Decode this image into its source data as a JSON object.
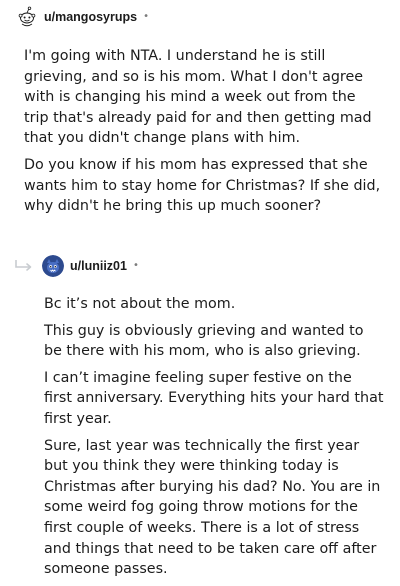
{
  "comments": [
    {
      "username": "u/mangosyrups",
      "avatar_icon": "snoo-avatar-icon",
      "separator": "•",
      "paragraphs": [
        "I'm going with NTA. I understand he is still grieving, and so is his mom. What I don't agree with is changing his mind a week out from the trip that's already paid for and then getting mad that you didn't change plans with him.",
        "Do you know if his mom has expressed that she wants him to stay home for Christmas? If she did, why didn't he bring this up much sooner?"
      ]
    },
    {
      "username": "u/luniiz01",
      "avatar_icon": "blue-creature-avatar-icon",
      "reply_icon": "reply-arrow-icon",
      "separator": "•",
      "paragraphs": [
        "Bc it’s not about the mom.",
        "This guy is obviously grieving and wanted to be there with his mom, who is also grieving.",
        "I can’t imagine feeling super festive on the first anniversary. Everything hits your hard that first year.",
        "Sure, last year was technically the first year but you think they were thinking today is Christmas after burying his dad? No. You are in some weird fog going throw motions for the first couple of weeks. There is a lot of stress and things that need to be taken care off after someone passes."
      ]
    }
  ],
  "colors": {
    "text": "#1c1c1c",
    "muted": "#7c7c7c",
    "reply_arrow": "#c8ccd0",
    "avatar2_bg": "#2d4a8f"
  }
}
